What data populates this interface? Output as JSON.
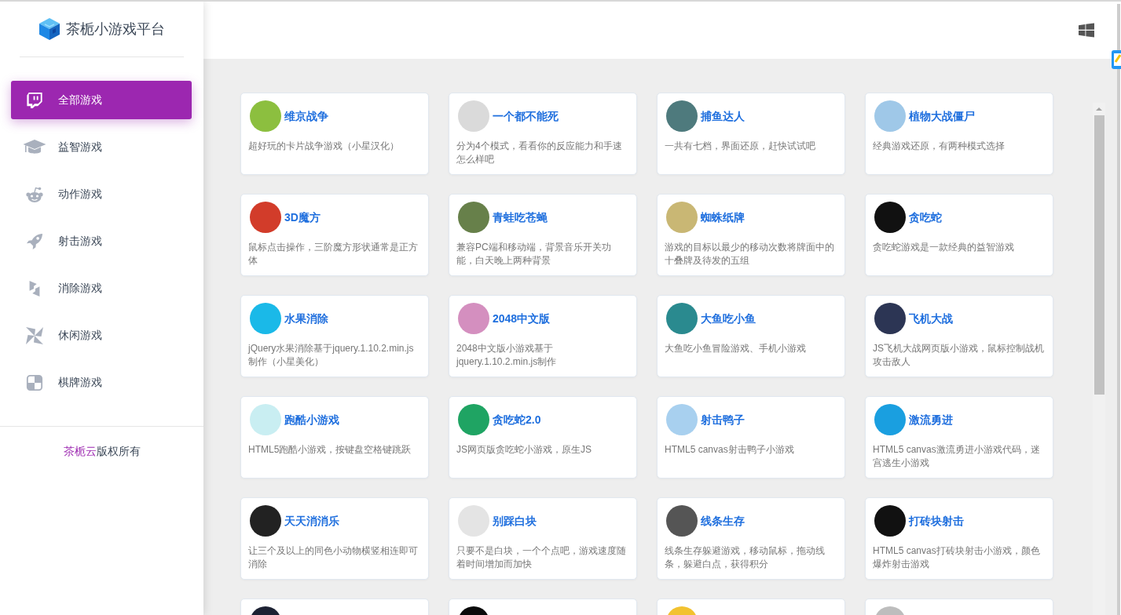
{
  "sidebar": {
    "title": "茶栀小游戏平台",
    "items": [
      {
        "label": "全部游戏",
        "selected": true
      },
      {
        "label": "益智游戏",
        "selected": false
      },
      {
        "label": "动作游戏",
        "selected": false
      },
      {
        "label": "射击游戏",
        "selected": false
      },
      {
        "label": "消除游戏",
        "selected": false
      },
      {
        "label": "休闲游戏",
        "selected": false
      },
      {
        "label": "棋牌游戏",
        "selected": false
      }
    ],
    "footer": {
      "link": "茶栀云",
      "text": "版权所有"
    }
  },
  "games": [
    {
      "title": "维京战争",
      "description": "超好玩的卡片战争游戏（小星汉化）",
      "color": "#8cbf3f"
    },
    {
      "title": "一个都不能死",
      "description": "分为4个模式，看看你的反应能力和手速怎么样吧",
      "color": "#dadada"
    },
    {
      "title": "捕鱼达人",
      "description": "一共有七档，界面还原，赶快试试吧",
      "color": "#4e7a7d"
    },
    {
      "title": "植物大战僵尸",
      "description": "经典游戏还原，有两种模式选择",
      "color": "#9fc8e8"
    },
    {
      "title": "3D魔方",
      "description": "鼠标点击操作，三阶魔方形状通常是正方体",
      "color": "#d23c2a"
    },
    {
      "title": "青蛙吃苍蝇",
      "description": "兼容PC端和移动端，背景音乐开关功能，白天晚上两种背景",
      "color": "#67804a"
    },
    {
      "title": "蜘蛛纸牌",
      "description": "游戏的目标以最少的移动次数将牌面中的十叠牌及待发的五组",
      "color": "#c9b774"
    },
    {
      "title": "贪吃蛇",
      "description": "贪吃蛇游戏是一款经典的益智游戏",
      "color": "#111111"
    },
    {
      "title": "水果消除",
      "description": "jQuery水果消除基于jquery.1.10.2.min.js制作（小星美化）",
      "color": "#1ab9e8"
    },
    {
      "title": "2048中文版",
      "description": "2048中文版小游戏基于jquery.1.10.2.min.js制作",
      "color": "#d48fbf"
    },
    {
      "title": "大鱼吃小鱼",
      "description": "大鱼吃小鱼冒险游戏、手机小游戏",
      "color": "#2a8a8f"
    },
    {
      "title": "飞机大战",
      "description": "JS飞机大战网页版小游戏，鼠标控制战机攻击敌人",
      "color": "#2c3554"
    },
    {
      "title": "跑酷小游戏",
      "description": "HTML5跑酷小游戏，按键盘空格键跳跃",
      "color": "#c9eef2"
    },
    {
      "title": "贪吃蛇2.0",
      "description": "JS网页版贪吃蛇小游戏，原生JS",
      "color": "#1fa463"
    },
    {
      "title": "射击鸭子",
      "description": "HTML5 canvas射击鸭子小游戏",
      "color": "#a8d0ef"
    },
    {
      "title": "激流勇进",
      "description": "HTML5 canvas激流勇进小游戏代码，迷宫逃生小游戏",
      "color": "#1a9fe0"
    },
    {
      "title": "天天消消乐",
      "description": "让三个及以上的同色小动物横竖相连即可消除",
      "color": "#222222"
    },
    {
      "title": "别踩白块",
      "description": "只要不是白块，一个个点吧，游戏速度随着时间增加而加快",
      "color": "#e4e4e4"
    },
    {
      "title": "线条生存",
      "description": "线条生存躲避游戏，移动鼠标，拖动线条，躲避白点，获得积分",
      "color": "#555555"
    },
    {
      "title": "打砖块射击",
      "description": "HTML5 canvas打砖块射击小游戏，颜色爆炸射击游戏",
      "color": "#111111"
    },
    {
      "color": "#1d2233"
    },
    {
      "color": "#0a0a0a"
    },
    {
      "color": "#f2c230"
    },
    {
      "color": "#bdbdbd"
    }
  ]
}
